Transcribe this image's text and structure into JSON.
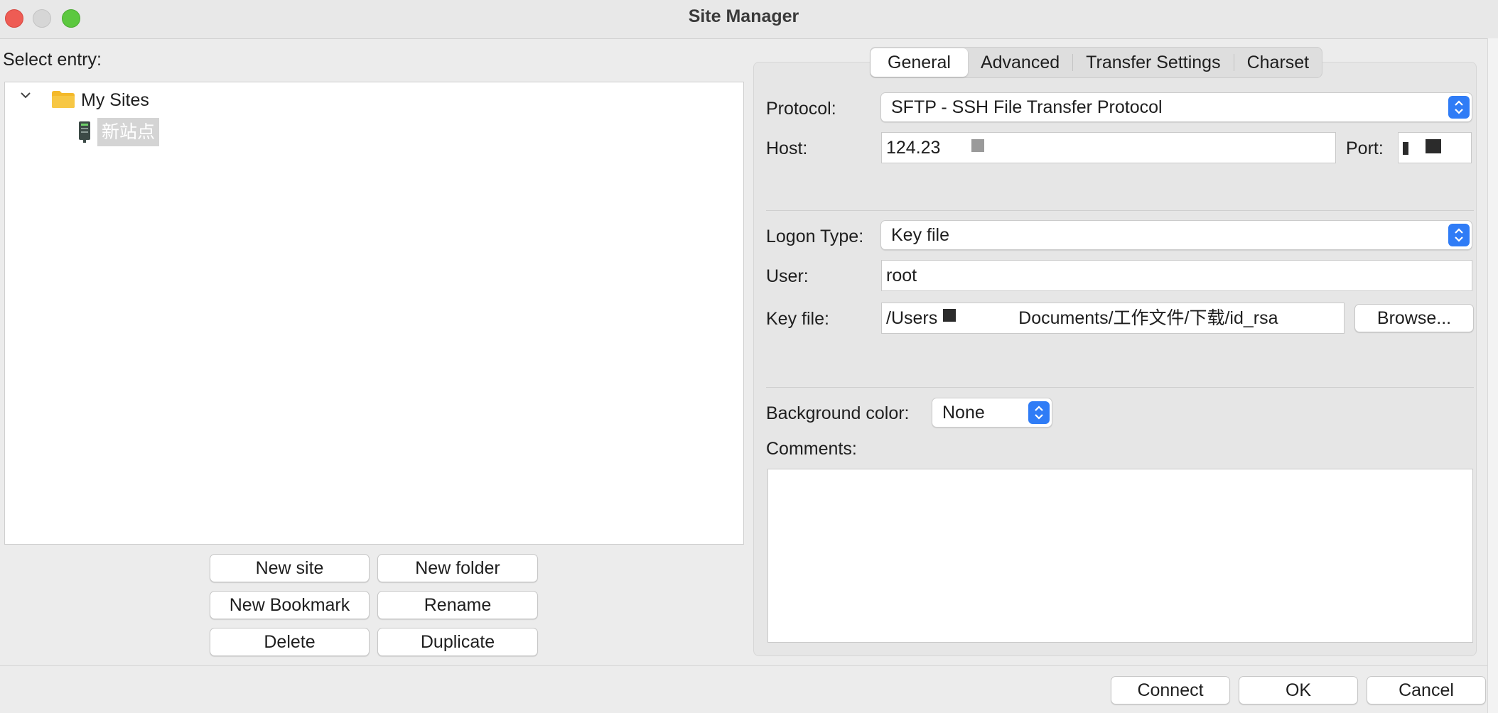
{
  "window": {
    "title": "Site Manager"
  },
  "left": {
    "select_label": "Select entry:",
    "tree": {
      "root_label": "My Sites",
      "site_label": "新站点"
    },
    "buttons": {
      "new_site": "New site",
      "new_folder": "New folder",
      "new_bookmark": "New Bookmark",
      "rename": "Rename",
      "delete": "Delete",
      "duplicate": "Duplicate"
    }
  },
  "tabs": [
    "General",
    "Advanced",
    "Transfer Settings",
    "Charset"
  ],
  "general": {
    "protocol_label": "Protocol:",
    "protocol_value": "SFTP - SSH File Transfer Protocol",
    "host_label": "Host:",
    "host_value": "124.23",
    "port_label": "Port:",
    "logon_type_label": "Logon Type:",
    "logon_type_value": "Key file",
    "user_label": "User:",
    "user_value": "root",
    "key_file_label": "Key file:",
    "key_file_prefix": "/Users",
    "key_file_suffix": "Documents/工作文件/下载/id_rsa",
    "browse_label": "Browse...",
    "bg_color_label": "Background color:",
    "bg_color_value": "None",
    "comments_label": "Comments:"
  },
  "footer": {
    "connect": "Connect",
    "ok": "OK",
    "cancel": "Cancel"
  },
  "colors": {
    "accent": "#2f7cf6",
    "close": "#ee5c54",
    "maximize": "#5cc83f",
    "folder": "#f4b92a"
  }
}
